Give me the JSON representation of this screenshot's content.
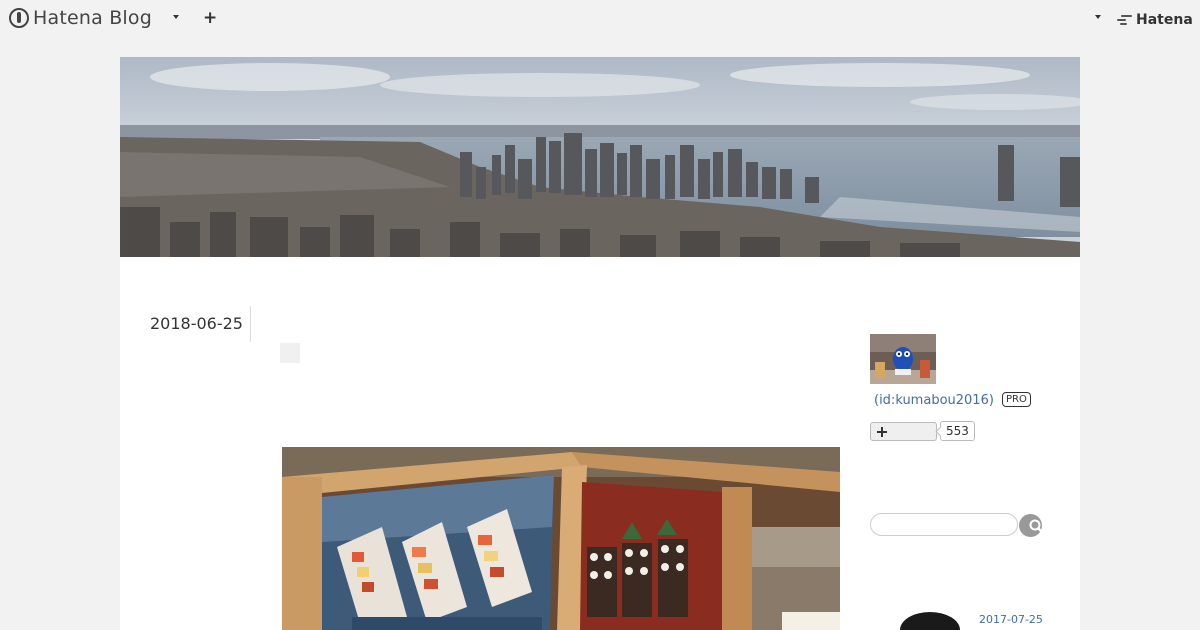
{
  "globalheader": {
    "brand": "Hatena Blog",
    "plus": "+",
    "hatena": "Hatena"
  },
  "entry": {
    "date": "2018-06-25"
  },
  "sidebar": {
    "profile_id": "(id:kumabou2016)",
    "pro_badge": "PRO",
    "follower_count": "553",
    "recent": {
      "date": "2017-07-25"
    }
  },
  "colors": {
    "link": "#3f6fa0",
    "page_background": "#f2f2f2",
    "content_background": "#ffffff"
  }
}
